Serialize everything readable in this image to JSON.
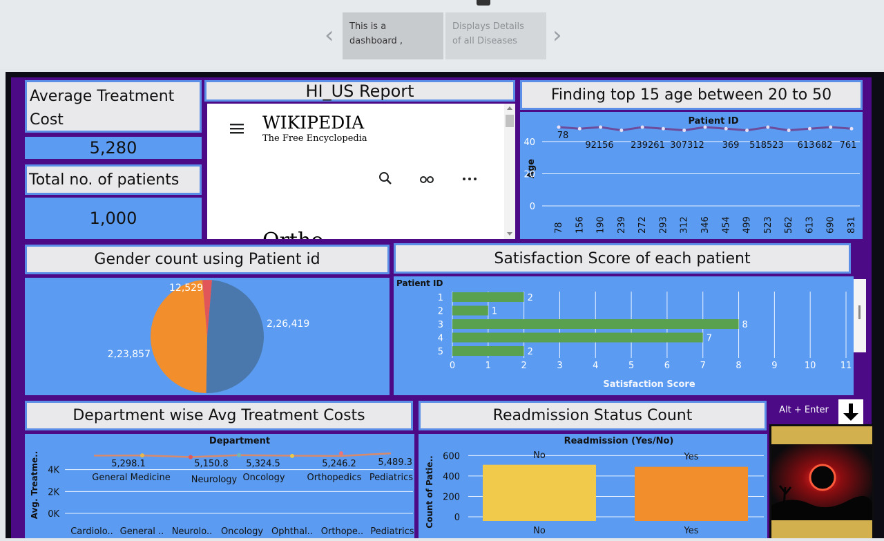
{
  "story": {
    "points": [
      {
        "line1": "This is a",
        "line2": "dashboard ,"
      },
      {
        "line1": "Displays Details",
        "line2": "of all Diseases"
      }
    ]
  },
  "kpi": {
    "avg_cost_title_line1": "Average Treatment",
    "avg_cost_title_line2": "Cost",
    "avg_cost_value": "5,280",
    "patients_title": "Total no. of patients",
    "patients_value": "1,000"
  },
  "web": {
    "title": "HI_US Report",
    "wiki_name": "Wikipedia",
    "wiki_tagline": "The Free Encyclopedia",
    "partial_text": "Ortho"
  },
  "age_chart": {
    "title": "Finding top 15 age between 20 to 50",
    "chart_data": {
      "type": "line",
      "header": "Patient ID",
      "ylabel": "Age",
      "yticks": [
        "0",
        "20",
        "40"
      ],
      "ylim": [
        0,
        55
      ],
      "categories": [
        "78",
        "156",
        "190",
        "239",
        "272",
        "293",
        "312",
        "346",
        "454",
        "499",
        "523",
        "562",
        "613",
        "690",
        "831"
      ],
      "ids": [
        "78",
        "92",
        "156",
        "239",
        "261",
        "307",
        "312",
        "369",
        "518",
        "523",
        "613",
        "682",
        "761"
      ],
      "id_labels": [
        "78",
        "92156",
        "239261",
        "307312",
        "369",
        "518523",
        "613",
        "682",
        "761"
      ],
      "values": [
        49,
        48,
        49,
        47,
        49,
        48,
        47,
        49,
        48,
        47,
        49,
        47,
        48,
        49,
        48
      ]
    }
  },
  "gender": {
    "title": "Gender count using Patient id",
    "chart_data": {
      "type": "pie",
      "values": [
        226419,
        223857,
        12529
      ],
      "labels": [
        "2,26,419",
        "2,23,857",
        "12,529"
      ],
      "colors": [
        "#4a78ad",
        "#f28e2b",
        "#e15759"
      ]
    }
  },
  "satisfaction": {
    "title": "Satisfaction Score of each patient",
    "chart_data": {
      "type": "bar",
      "header": "Patient ID",
      "xlabel": "Satisfaction Score",
      "categories": [
        "1",
        "2",
        "3",
        "4",
        "5"
      ],
      "values": [
        2,
        1,
        8,
        7,
        2
      ],
      "xlim": [
        0,
        11
      ],
      "xticks": [
        "0",
        "1",
        "2",
        "3",
        "4",
        "5",
        "6",
        "7",
        "8",
        "9",
        "10",
        "11"
      ],
      "color": "#59a14f"
    }
  },
  "department": {
    "title": "Department wise Avg Treatment Costs",
    "chart_data": {
      "type": "line",
      "header": "Department",
      "ylabel": "Avg. Treatme..",
      "yticks": [
        "0K",
        "2K",
        "4K"
      ],
      "ylim": [
        0,
        6000
      ],
      "categories": [
        "Cardiolo..",
        "General ..",
        "Neurolo..",
        "Oncology",
        "Ophthal..",
        "Orthope..",
        "Pediatrics"
      ],
      "points": [
        {
          "name": "General Medicine",
          "value": 5298.1,
          "label": "5,298.1"
        },
        {
          "name": "Neurology",
          "value": 5150.8,
          "label": "5,150.8"
        },
        {
          "name": "Oncology",
          "value": 5324.5,
          "label": "5,324.5"
        },
        {
          "name": "Orthopedics",
          "value": 5246.2,
          "label": "5,246.2"
        },
        {
          "name": "Pediatrics",
          "value": 5489.3,
          "label": "5,489.3"
        }
      ]
    }
  },
  "readmission": {
    "title": "Readmission Status Count",
    "chart_data": {
      "type": "bar",
      "header": "Readmission (Yes/No)",
      "ylabel": "Count of Patie..",
      "categories": [
        "No",
        "Yes"
      ],
      "values": [
        510,
        490
      ],
      "ylim": [
        0,
        650
      ],
      "yticks": [
        "0",
        "200",
        "400",
        "600"
      ],
      "colors": [
        "#f1c94b",
        "#f28e2b"
      ]
    }
  },
  "hotkey": {
    "label": "Alt + Enter"
  }
}
